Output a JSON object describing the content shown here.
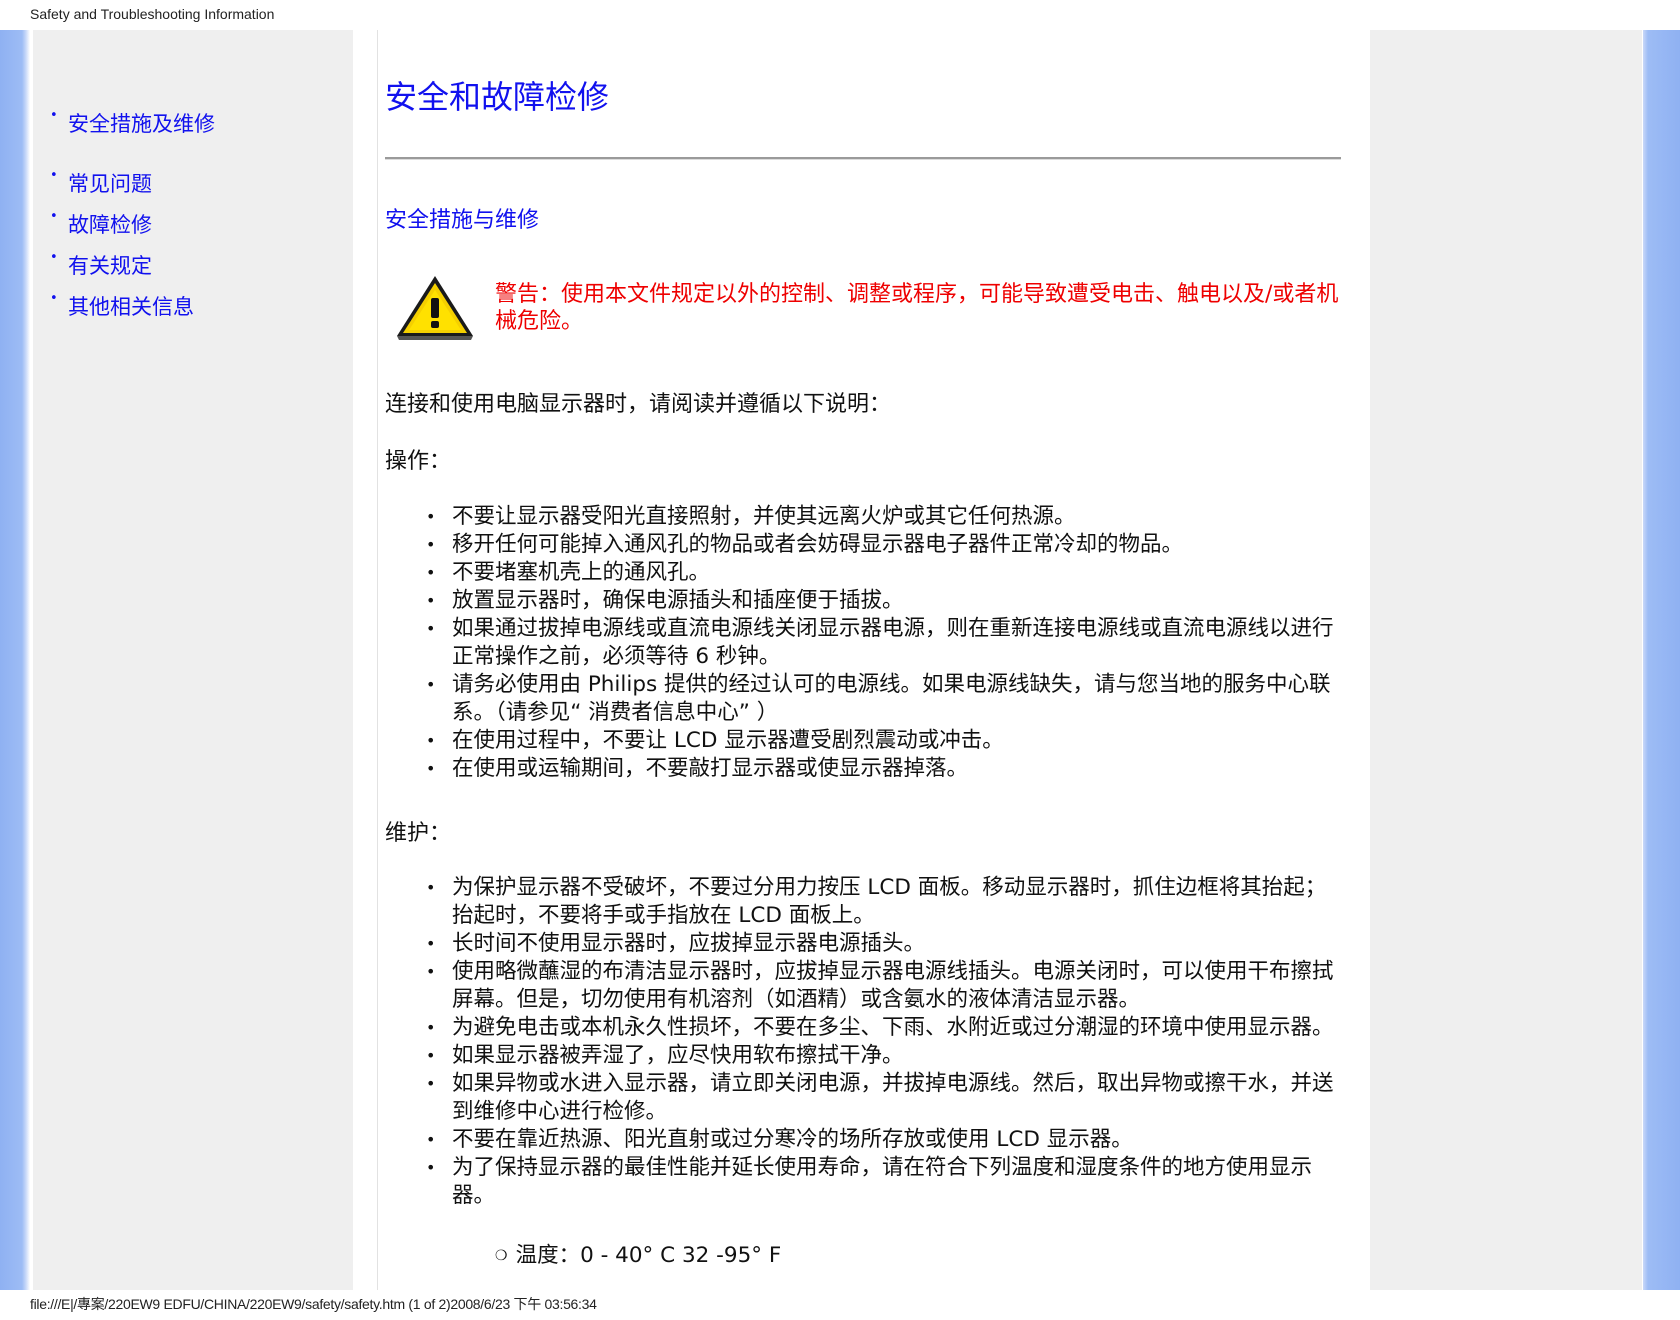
{
  "print_header": "Safety and Troubleshooting Information",
  "print_footer": "file:///E|/專案/220EW9 EDFU/CHINA/220EW9/safety/safety.htm (1 of 2)2008/6/23 下午 03:56:34",
  "nav": {
    "items": [
      {
        "label": "安全措施及维修"
      },
      {
        "label": "常见问题"
      },
      {
        "label": "故障检修"
      },
      {
        "label": "有关规定"
      },
      {
        "label": "其他相关信息"
      }
    ]
  },
  "main": {
    "title": "安全和故障检修",
    "section_title": "安全措施与维修",
    "warning": "警告：使用本文件规定以外的控制、调整或程序，可能导致遭受电击、触电以及/或者机械危险。",
    "intro": "连接和使用电脑显示器时，请阅读并遵循以下说明：",
    "operation_heading": "操作：",
    "operation_items": [
      "不要让显示器受阳光直接照射，并使其远离火炉或其它任何热源。",
      "移开任何可能掉入通风孔的物品或者会妨碍显示器电子器件正常冷却的物品。",
      "不要堵塞机壳上的通风孔。",
      "放置显示器时，确保电源插头和插座便于插拔。",
      "如果通过拔掉电源线或直流电源线关闭显示器电源，则在重新连接电源线或直流电源线以进行正常操作之前，必须等待 6 秒钟。",
      "请务必使用由 Philips 提供的经过认可的电源线。如果电源线缺失，请与您当地的服务中心联系。（请参见“ 消费者信息中心” ）",
      "在使用过程中，不要让 LCD 显示器遭受剧烈震动或冲击。",
      "在使用或运输期间，不要敲打显示器或使显示器掉落。"
    ],
    "maintenance_heading": "维护：",
    "maintenance_items": [
      "为保护显示器不受破坏，不要过分用力按压 LCD 面板。移动显示器时，抓住边框将其抬起；抬起时，不要将手或手指放在 LCD 面板上。",
      "长时间不使用显示器时，应拔掉显示器电源插头。",
      "使用略微蘸湿的布清洁显示器时，应拔掉显示器电源线插头。电源关闭时，可以使用干布擦拭屏幕。但是，切勿使用有机溶剂（如酒精）或含氨水的液体清洁显示器。",
      "为避免电击或本机永久性损坏，不要在多尘、下雨、水附近或过分潮湿的环境中使用显示器。",
      "如果显示器被弄湿了，应尽快用软布擦拭干净。",
      "如果异物或水进入显示器，请立即关闭电源，并拔掉电源线。然后，取出异物或擦干水，并送到维修中心进行检修。",
      "不要在靠近热源、阳光直射或过分寒冷的场所存放或使用 LCD 显示器。",
      "为了保持显示器的最佳性能并延长使用寿命，请在符合下列温度和湿度条件的地方使用显示器。"
    ],
    "temperature": "温度：0 - 40°  C 32 -95°  F"
  },
  "colors": {
    "link": "#1111ee",
    "warning": "#ee0000",
    "side_panel": "#efefef",
    "band": "#9dbcf5"
  }
}
